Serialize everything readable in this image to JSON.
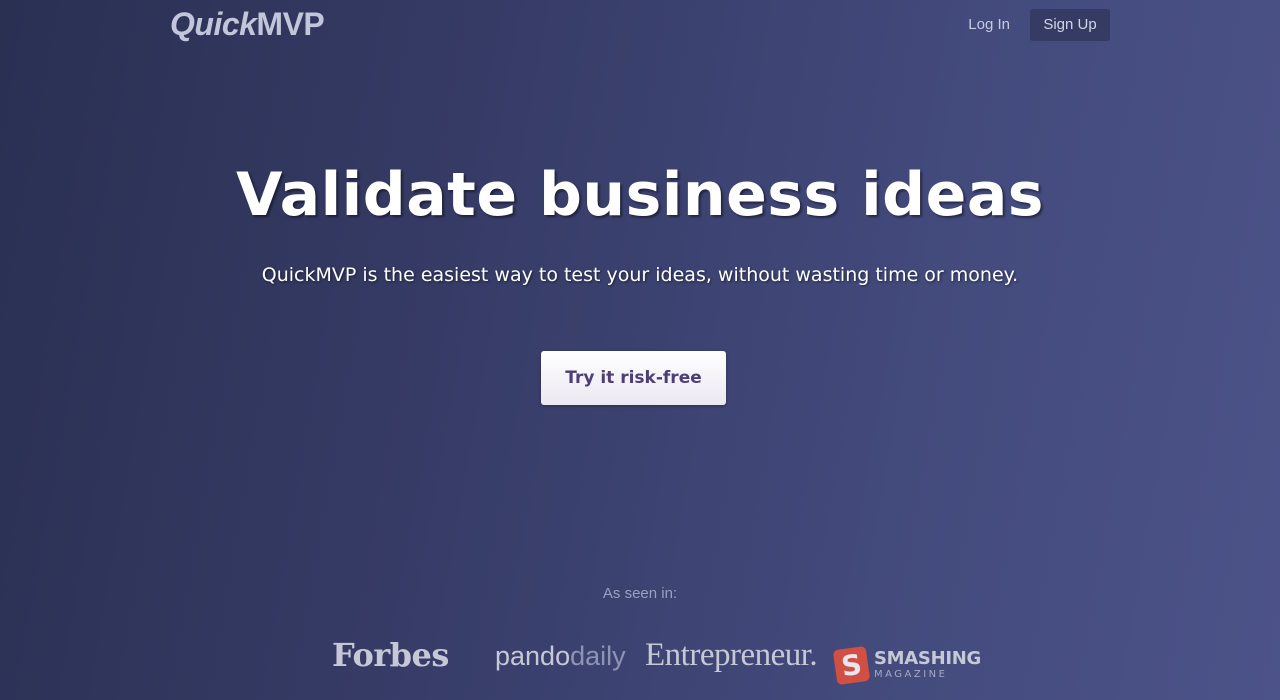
{
  "header": {
    "logo_part1": "Quick",
    "logo_part2": "MVP",
    "login_label": "Log In",
    "signup_label": "Sign Up"
  },
  "hero": {
    "title": "Validate business ideas",
    "subtitle": "QuickMVP is the easiest way to test your ideas, without wasting time or money.",
    "cta_label": "Try it risk-free"
  },
  "press": {
    "heading": "As seen in:",
    "logos": {
      "forbes": "Forbes",
      "pando_bold": "pando",
      "pando_light": "daily",
      "entrepreneur": "Entrepreneur.",
      "smashing_badge": "S",
      "smashing_top": "SMASHING",
      "smashing_bottom": "MAGAZINE"
    }
  },
  "colors": {
    "background_start": "#2a3052",
    "background_end": "#4c5388",
    "cta_text": "#4e3e78",
    "smashing_red": "#d24f43"
  }
}
